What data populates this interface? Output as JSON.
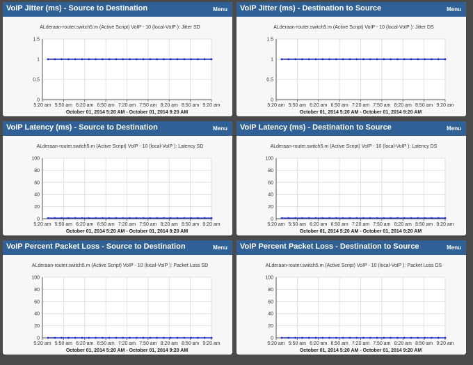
{
  "menu_label": "Menu",
  "widgets": [
    {
      "title": "VoIP Jitter (ms) - Source to Destination",
      "chart_data": {
        "type": "line",
        "title": "ALderaan-router.switch5.m (Active Script) VoIP - 10 (local-VoIP ): Jitter SD",
        "xlabel": "October 01, 2014 5:20 AM - October 01, 2014 9:20 AM",
        "ylabel": "",
        "ylim": [
          0,
          1.5
        ],
        "yticks": [
          "0",
          "0.5",
          "1",
          "1.5"
        ],
        "xticks": [
          "5:20 am",
          "5:50 am",
          "6:20 am",
          "6:50 am",
          "7:20 am",
          "7:50 am",
          "8:20 am",
          "8:50 am",
          "9:20 am"
        ],
        "series": [
          {
            "values": [
              1,
              1,
              1,
              1,
              1,
              1,
              1,
              1,
              1,
              1,
              1,
              1,
              1,
              1,
              1,
              1,
              1,
              1,
              1,
              1,
              1,
              1,
              1,
              1,
              1
            ]
          }
        ],
        "grid": true
      }
    },
    {
      "title": "VoIP Jitter (ms) - Destination to Source",
      "chart_data": {
        "type": "line",
        "title": "ALderaan-router.switch5.m (Active Script) VoIP - 10 (local-VoIP ): Jitter DS",
        "xlabel": "October 01, 2014 5:20 AM - October 01, 2014 9:20 AM",
        "ylabel": "",
        "ylim": [
          0,
          1.5
        ],
        "yticks": [
          "0",
          "0.5",
          "1",
          "1.5"
        ],
        "xticks": [
          "5:20 am",
          "5:50 am",
          "6:20 am",
          "6:50 am",
          "7:20 am",
          "7:50 am",
          "8:20 am",
          "8:50 am",
          "9:20 am"
        ],
        "series": [
          {
            "values": [
              1,
              1,
              1,
              1,
              1,
              1,
              1,
              1,
              1,
              1,
              1,
              1,
              1,
              1,
              1,
              1,
              1,
              1,
              1,
              1,
              1,
              1,
              1,
              1,
              1
            ]
          }
        ],
        "grid": true
      }
    },
    {
      "title": "VoIP Latency (ms) - Source to Destination",
      "chart_data": {
        "type": "line",
        "title": "ALderaan-router.switch5.m (Active Script) VoIP - 10 (local-VoIP ): Latency SD",
        "xlabel": "October 01, 2014 5:20 AM - October 01, 2014 9:20 AM",
        "ylabel": "",
        "ylim": [
          0,
          100
        ],
        "yticks": [
          "0",
          "20",
          "40",
          "60",
          "80",
          "100"
        ],
        "xticks": [
          "5:20 am",
          "5:50 am",
          "6:20 am",
          "6:50 am",
          "7:20 am",
          "7:50 am",
          "8:20 am",
          "8:50 am",
          "9:20 am"
        ],
        "series": [
          {
            "values": [
              1,
              1,
              1,
              1,
              1,
              1,
              1,
              1,
              1,
              1,
              1,
              1,
              1,
              1,
              1,
              1,
              1,
              1,
              1,
              1,
              1,
              1,
              1,
              1,
              1
            ]
          }
        ],
        "grid": true
      }
    },
    {
      "title": "VoIP Latency (ms) - Destination to Source",
      "chart_data": {
        "type": "line",
        "title": "ALderaan-router.switch5.m (Active Script) VoIP - 10 (local-VoIP ): Latency DS",
        "xlabel": "October 01, 2014 5:20 AM - October 01, 2014 9:20 AM",
        "ylabel": "",
        "ylim": [
          0,
          100
        ],
        "yticks": [
          "0",
          "20",
          "40",
          "60",
          "80",
          "100"
        ],
        "xticks": [
          "5:20 am",
          "5:50 am",
          "6:20 am",
          "6:50 am",
          "7:20 am",
          "7:50 am",
          "8:20 am",
          "8:50 am",
          "9:20 am"
        ],
        "series": [
          {
            "values": [
              1,
              1,
              1,
              1,
              1,
              1,
              1,
              1,
              1,
              1,
              1,
              1,
              1,
              1,
              1,
              1,
              1,
              1,
              1,
              1,
              1,
              1,
              1,
              1,
              1
            ]
          }
        ],
        "grid": true
      }
    },
    {
      "title": "VoIP Percent Packet Loss - Source to Destination",
      "chart_data": {
        "type": "line",
        "title": "ALderaan-router.switch5.m (Active Script) VoIP - 10 (local-VoIP ): Packet Loss SD",
        "xlabel": "October 01, 2014 5:20 AM - October 01, 2014 9:20 AM",
        "ylabel": "",
        "ylim": [
          0,
          100
        ],
        "yticks": [
          "0",
          "20",
          "40",
          "60",
          "80",
          "100"
        ],
        "xticks": [
          "5:20 am",
          "5:50 am",
          "6:20 am",
          "6:50 am",
          "7:20 am",
          "7:50 am",
          "8:20 am",
          "8:50 am",
          "9:20 am"
        ],
        "series": [
          {
            "values": [
              0,
              0,
              0,
              0,
              0,
              0,
              0,
              0,
              0,
              0,
              0,
              0,
              0,
              0,
              0,
              0,
              0,
              0,
              0,
              0,
              0,
              0,
              0,
              0,
              0
            ]
          }
        ],
        "grid": true
      }
    },
    {
      "title": "VoIP Percent Packet Loss - Destination to Source",
      "chart_data": {
        "type": "line",
        "title": "ALderaan-router.switch5.m (Active Script) VoIP - 10 (local-VoIP ): Packet Loss DS",
        "xlabel": "October 01, 2014 5:20 AM - October 01, 2014 9:20 AM",
        "ylabel": "",
        "ylim": [
          0,
          100
        ],
        "yticks": [
          "0",
          "20",
          "40",
          "60",
          "80",
          "100"
        ],
        "xticks": [
          "5:20 am",
          "5:50 am",
          "6:20 am",
          "6:50 am",
          "7:20 am",
          "7:50 am",
          "8:20 am",
          "8:50 am",
          "9:20 am"
        ],
        "series": [
          {
            "values": [
              0,
              0,
              0,
              0,
              0,
              0,
              0,
              0,
              0,
              0,
              0,
              0,
              0,
              0,
              0,
              0,
              0,
              0,
              0,
              0,
              0,
              0,
              0,
              0,
              0
            ]
          }
        ],
        "grid": true
      }
    }
  ],
  "colors": {
    "header": "#2f6196",
    "series": "#1f2fbf",
    "grid": "#d8d8d8",
    "axis": "#555555"
  }
}
